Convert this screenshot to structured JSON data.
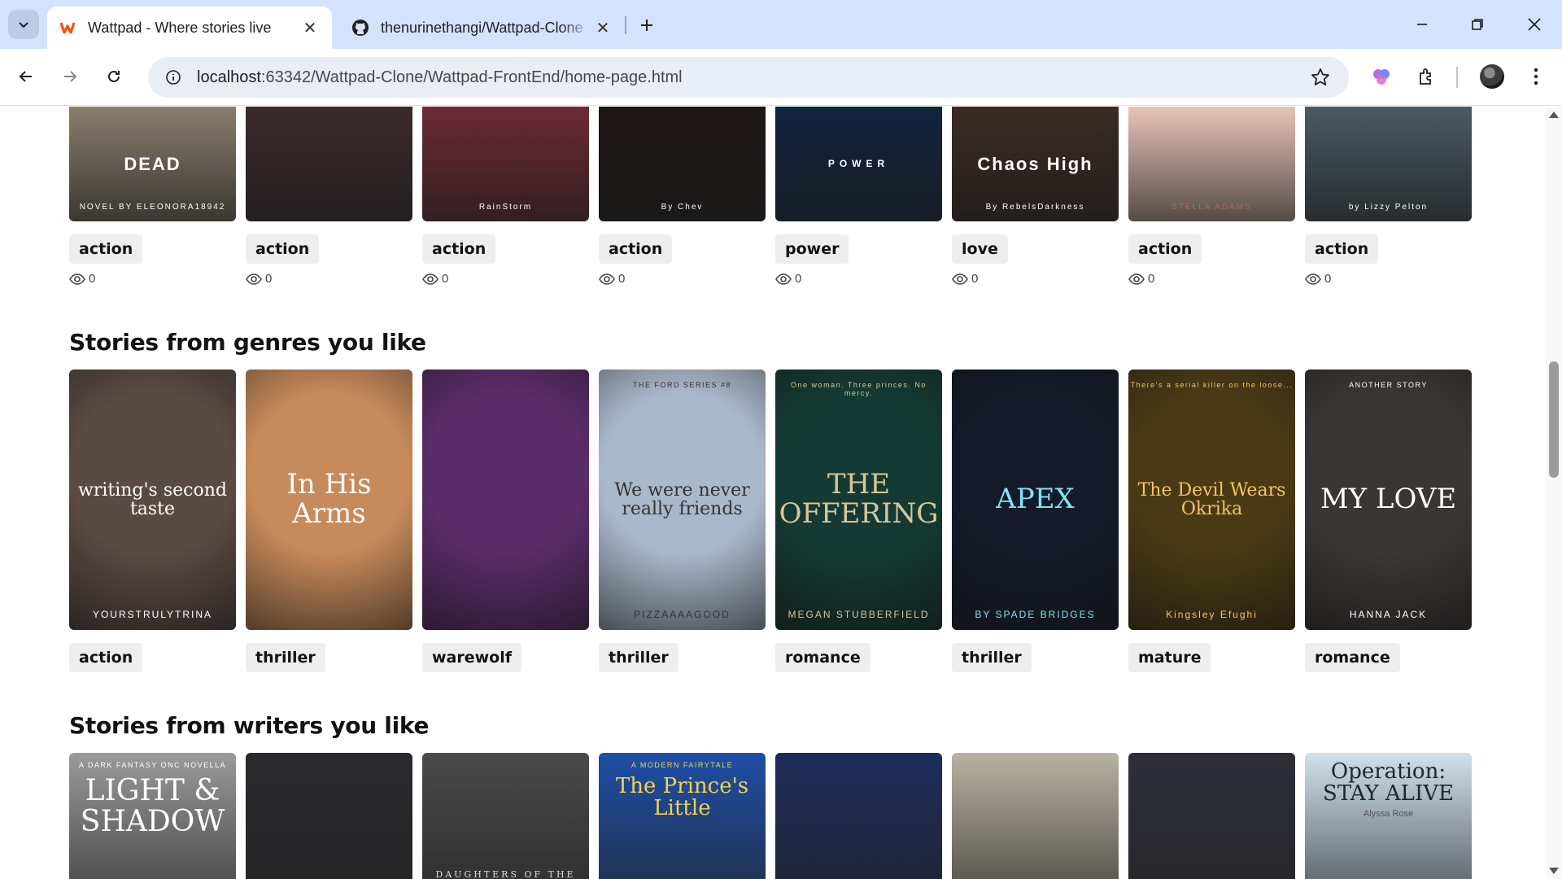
{
  "browser": {
    "tabs": [
      {
        "title": "Wattpad - Where stories live",
        "active": true
      },
      {
        "title": "thenurinethangi/Wattpad-Clone",
        "active": false
      }
    ],
    "url_host": "localhost",
    "url_rest": ":63342/Wattpad-Clone/Wattpad-FrontEnd/home-page.html"
  },
  "top_row": [
    {
      "tag": "action",
      "views": "0",
      "cover_text": "DEAD",
      "cover_author": "NOVEL BY ELEONORA18942",
      "bg": "#8a7f6e"
    },
    {
      "tag": "action",
      "views": "0",
      "cover_text": "",
      "cover_author": "",
      "bg": "#3b2a2c"
    },
    {
      "tag": "action",
      "views": "0",
      "cover_text": "",
      "cover_author": "RainStorm",
      "bg": "#6e2a36"
    },
    {
      "tag": "action",
      "views": "0",
      "cover_text": "",
      "cover_author": "By Chev",
      "bg": "#1c1614"
    },
    {
      "tag": "power",
      "views": "0",
      "cover_text": "POWER",
      "cover_author": "",
      "bg": "#112440"
    },
    {
      "tag": "love",
      "views": "0",
      "cover_text": "Chaos High",
      "cover_author": "By RebelsDarkness",
      "bg": "#3a2a24"
    },
    {
      "tag": "action",
      "views": "0",
      "cover_text": "",
      "cover_author": "STELLA ADAMS",
      "bg": "#e8c5b8"
    },
    {
      "tag": "action",
      "views": "0",
      "cover_text": "",
      "cover_author": "by Lizzy Pelton",
      "bg": "#4a5a63"
    }
  ],
  "genres_section": {
    "heading": "Stories from genres you like",
    "books": [
      {
        "tag": "action",
        "cover_top": "",
        "cover_title": "writing's second taste",
        "cover_author": "YOURSTRULYTRINA",
        "bg": "#5a4a44",
        "fg": "#ffffff"
      },
      {
        "tag": "thriller",
        "cover_top": "",
        "cover_title": "In His Arms",
        "cover_author": "",
        "bg": "#c78a5a",
        "fg": "#ffffff"
      },
      {
        "tag": "warewolf",
        "cover_top": "",
        "cover_title": "",
        "cover_author": "",
        "bg": "#5a2c6a",
        "fg": "#ffffff"
      },
      {
        "tag": "thriller",
        "cover_top": "THE FORD SERIES #8",
        "cover_title": "We were never really friends",
        "cover_author": "PIZZAAAAGOOD",
        "bg": "#a9b9cc",
        "fg": "#333333"
      },
      {
        "tag": "romance",
        "cover_top": "One woman. Three princes. No mercy.",
        "cover_title": "THE OFFERING",
        "cover_author": "MEGAN STUBBERFIELD",
        "bg": "#143a33",
        "fg": "#d7c79a"
      },
      {
        "tag": "thriller",
        "cover_top": "",
        "cover_title": "APEX",
        "cover_author": "BY SPADE BRIDGES",
        "bg": "#141a2a",
        "fg": "#7fe4ee"
      },
      {
        "tag": "mature",
        "cover_top": "There's a serial killer on the loose...",
        "cover_title": "The Devil Wears Okrika",
        "cover_author": "Kingsley Efughi",
        "bg": "#4a3a14",
        "fg": "#f3c36a"
      },
      {
        "tag": "romance",
        "cover_top": "ANOTHER STORY",
        "cover_title": "MY LOVE",
        "cover_author": "HANNA JACK",
        "bg": "#3a3633",
        "fg": "#ffffff"
      }
    ]
  },
  "writers_section": {
    "heading": "Stories from writers you like",
    "books": [
      {
        "cover_top": "A DARK FANTASY ONC NOVELLA",
        "cover_title": "LIGHT & SHADOW",
        "bg": "#9a9a9a",
        "fg": "#ffffff"
      },
      {
        "cover_top": "",
        "cover_title": "",
        "bg": "#2a2a2e",
        "fg": "#ffffff"
      },
      {
        "cover_top": "",
        "cover_title": "DAUGHTERS OF THE",
        "bg": "#4a4a4a",
        "fg": "#dddddd"
      },
      {
        "cover_top": "A MODERN FAIRYTALE",
        "cover_title": "The Prince's Little",
        "bg": "#1e4fa8",
        "fg": "#f3d34a"
      },
      {
        "cover_top": "",
        "cover_title": "",
        "bg": "#1c2c5a",
        "fg": "#ffffff"
      },
      {
        "cover_top": "",
        "cover_title": "",
        "bg": "#b9b2a0",
        "fg": "#ffffff"
      },
      {
        "cover_top": "",
        "cover_title": "",
        "bg": "#2e2e3a",
        "fg": "#ffffff"
      },
      {
        "cover_top": "",
        "cover_title": "Operation: STAY ALIVE",
        "cover_sub": "Alyssa Rose",
        "bg": "#cfe1ee",
        "fg": "#1a2633"
      }
    ]
  }
}
